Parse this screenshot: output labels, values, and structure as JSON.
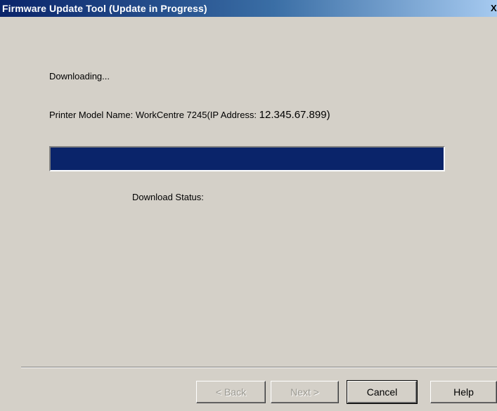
{
  "window": {
    "title": "Firmware Update Tool (Update in Progress)",
    "close_glyph": "X"
  },
  "content": {
    "status_text": "Downloading...",
    "model_label": "Printer Model Name: WorkCentre 7245(IP Address: ",
    "ip_value": "12.345.67.899)",
    "download_status_label": "Download Status:",
    "download_status_value": ""
  },
  "progress": {
    "fraction": 1.0,
    "fill_color": "#0a246a"
  },
  "buttons": {
    "back": "< Back",
    "next": "Next >",
    "cancel": "Cancel",
    "help": "Help"
  },
  "colors": {
    "window_bg": "#d4d0c8",
    "title_start": "#0a246a",
    "title_end": "#a6caf0",
    "disabled_text": "#9a9890"
  }
}
